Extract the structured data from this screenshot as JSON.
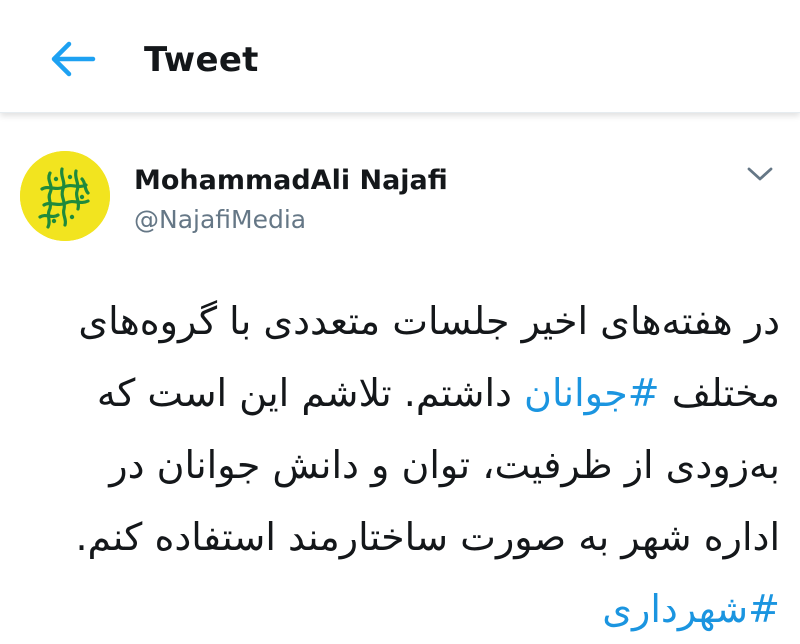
{
  "header": {
    "back_icon": "arrow-left-icon",
    "title": "Tweet",
    "accent_color": "#1da1f2"
  },
  "tweet": {
    "author": {
      "name": "MohammadAli Najafi",
      "handle": "@NajafiMedia",
      "avatar_color": "#f2e41f"
    },
    "menu_icon": "chevron-down-icon",
    "text": {
      "line1": "در هفته‌های اخیر جلسات متعددی با گروه‌های",
      "line2_pre": "مختلف",
      "line2_hashtag": "#جوانان",
      "line2_post": "داشتم. تلاشم این است که",
      "line3": "به‌زودی از ظرفیت، توان و دانش جوانان در",
      "line4": "اداره شهر به صورت ساختارمند استفاده کنم.",
      "line5_hashtag": "#شهرداری"
    },
    "hashtag_color": "#1b95e0"
  }
}
